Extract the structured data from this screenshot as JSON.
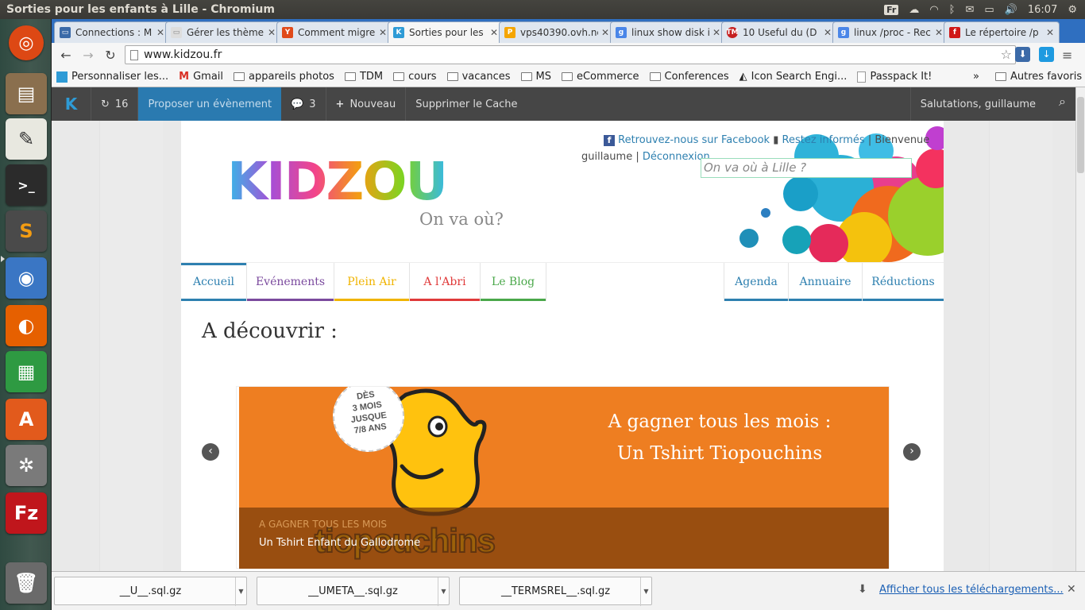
{
  "window": {
    "title": "Sorties pour les enfants à Lille - Chromium"
  },
  "tray": {
    "keyboard": "Fr",
    "time": "16:07"
  },
  "tabs": [
    {
      "label": "Connections : M",
      "favicon_color": "#3b6aa8"
    },
    {
      "label": "Gérer les thème",
      "favicon_color": "#e8e8e8"
    },
    {
      "label": "Comment migre",
      "favicon_color": "#e04a1a"
    },
    {
      "label": "Sorties pour les",
      "favicon_color": "#2e9bd6"
    },
    {
      "label": "vps40390.ovh.ne",
      "favicon_color": "#f5a500"
    },
    {
      "label": "linux show disk i",
      "favicon_color": "#4a86e8"
    },
    {
      "label": "10 Useful du (D",
      "favicon_color": "#c62020"
    },
    {
      "label": "linux /proc - Rec",
      "favicon_color": "#4a86e8"
    },
    {
      "label": "Le répertoire /p",
      "favicon_color": "#d01818"
    }
  ],
  "omnibox": {
    "url": "www.kidzou.fr"
  },
  "bookmarks": {
    "items": [
      "Personnaliser les...",
      "Gmail",
      "appareils photos",
      "TDM",
      "cours",
      "vacances",
      "MS",
      "eCommerce",
      "Conferences",
      "Icon Search Engi...",
      "Passpack It!"
    ],
    "more": "»",
    "other": "Autres favoris"
  },
  "adminbar": {
    "updates": "16",
    "propose": "Proposer un évènement",
    "comments": "3",
    "new": "Nouveau",
    "clear_cache": "Supprimer le Cache",
    "greeting": "Salutations, guillaume"
  },
  "header": {
    "logo": "KIDZOU",
    "tagline": "On va où?",
    "facebook": "Retrouvez-nous sur Facebook",
    "informed": "Restez informés",
    "welcome": "Bienvenue",
    "user": "guillaume",
    "logout": "Déconnexion",
    "search_placeholder": "On va où à Lille ?"
  },
  "nav": [
    {
      "label": "Accueil",
      "color": "#2e80b0"
    },
    {
      "label": "Evénements",
      "color": "#7b4a9e"
    },
    {
      "label": "Plein Air",
      "color": "#f0b400"
    },
    {
      "label": "A l'Abri",
      "color": "#e03a3a"
    },
    {
      "label": "Le Blog",
      "color": "#4aa84a"
    },
    {
      "label": "Agenda",
      "color": "#2e80b0"
    },
    {
      "label": "Annuaire",
      "color": "#2e80b0"
    },
    {
      "label": "Réductions",
      "color": "#2e80b0"
    }
  ],
  "main": {
    "heading": "A découvrir :"
  },
  "slide": {
    "badge": [
      "DÈS",
      "3 MOIS",
      "JUSQUE",
      "7/8 ANS"
    ],
    "promo_line1": "A gagner tous les mois :",
    "promo_line2": "Un Tshirt Tiopouchins",
    "brand": "tiopouchins",
    "caption_category": "A GAGNER TOUS LES MOIS",
    "caption_title": "Un Tshirt Enfant du Gallodrome"
  },
  "downloads": {
    "files": [
      "__U__.sql.gz",
      "__UMETA__.sql.gz",
      "__TERMSREL__.sql.gz"
    ],
    "show_all": "Afficher tous les téléchargements..."
  }
}
